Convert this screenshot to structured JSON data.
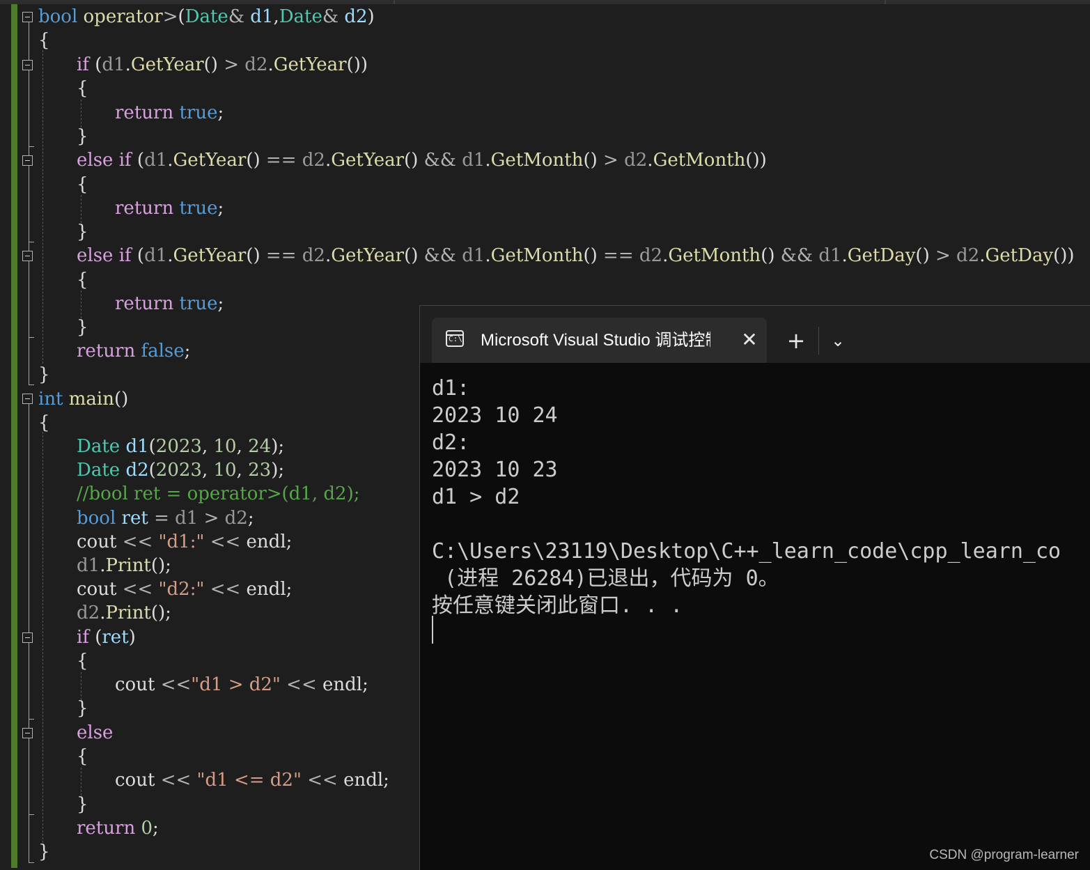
{
  "editor": {
    "code_lines": [
      "bool operator>(Date& d1,Date& d2)",
      "{",
      "if (d1.GetYear() > d2.GetYear())",
      "{",
      "return true;",
      "}",
      "else if (d1.GetYear() == d2.GetYear() && d1.GetMonth() > d2.GetMonth())",
      "{",
      "return true;",
      "}",
      "else if (d1.GetYear() == d2.GetYear() && d1.GetMonth() == d2.GetMonth() && d1.GetDay() > d2.GetDay())",
      "{",
      "return true;",
      "}",
      "return false;",
      "}",
      "int main()",
      "{",
      "Date d1(2023, 10, 24);",
      "Date d2(2023, 10, 23);",
      "//bool ret = operator>(d1, d2);",
      "bool ret = d1 > d2;",
      "cout << \"d1:\" << endl;",
      "d1.Print();",
      "cout << \"d2:\" << endl;",
      "d2.Print();",
      "if (ret)",
      "{",
      "cout <<\"d1 > d2\" << endl;",
      "}",
      "else",
      "{",
      "cout << \"d1 <= d2\" << endl;",
      "}",
      "return 0;",
      "}"
    ]
  },
  "console": {
    "tab_title": "Microsoft Visual Studio 调试控制台",
    "tab_icon": "console-icon",
    "close_glyph": "✕",
    "new_tab_glyph": "+",
    "dropdown_glyph": "⌄",
    "output_lines": [
      "d1:",
      "2023 10 24",
      "d2:",
      "2023 10 23",
      "d1 > d2",
      "",
      "C:\\Users\\23119\\Desktop\\C++_learn_code\\cpp_learn_co",
      " (进程 26284)已退出，代码为 0。",
      "按任意键关闭此窗口. . ."
    ]
  },
  "watermark": "CSDN @program-learner",
  "colors": {
    "editor_bg": "#1e1e1e",
    "keyword": "#569cd6",
    "control_keyword": "#d8a0df",
    "type": "#4ec9b0",
    "function": "#dcdcaa",
    "variable": "#9cdcfe",
    "number": "#b5cea8",
    "string": "#d69d85",
    "comment": "#57a64a",
    "change_bar": "#4f7a2c",
    "console_bg": "#0c0c0c",
    "console_text": "#cccccc"
  }
}
